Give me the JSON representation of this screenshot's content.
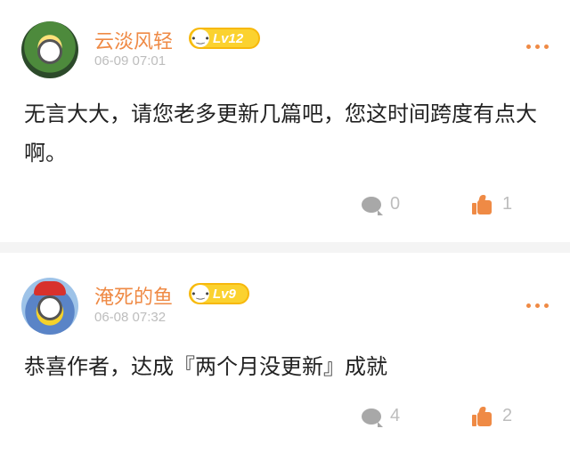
{
  "comments": [
    {
      "username": "云淡风轻",
      "level": "Lv12",
      "timestamp": "06-09 07:01",
      "content": "无言大大，请您老多更新几篇吧，您这时间跨度有点大啊。",
      "comment_count": "0",
      "like_count": "1"
    },
    {
      "username": "淹死的鱼",
      "level": "Lv9",
      "timestamp": "06-08 07:32",
      "content": "恭喜作者，达成『两个月没更新』成就",
      "comment_count": "4",
      "like_count": "2"
    }
  ],
  "colors": {
    "accent": "#ef8a45",
    "badge": "#fbd22f",
    "meta": "#bdbdbd",
    "text": "#222222"
  },
  "icons": [
    "more-icon",
    "comment-icon",
    "thumbs-up-icon",
    "level-badge-icon"
  ]
}
